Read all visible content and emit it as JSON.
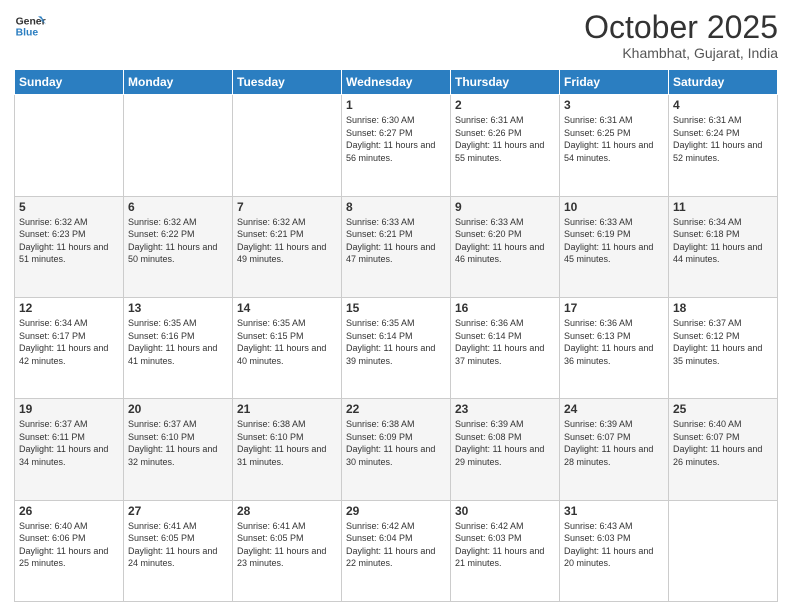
{
  "header": {
    "logo_line1": "General",
    "logo_line2": "Blue",
    "month": "October 2025",
    "location": "Khambhat, Gujarat, India"
  },
  "weekdays": [
    "Sunday",
    "Monday",
    "Tuesday",
    "Wednesday",
    "Thursday",
    "Friday",
    "Saturday"
  ],
  "weeks": [
    [
      {
        "day": "",
        "sunrise": "",
        "sunset": "",
        "daylight": ""
      },
      {
        "day": "",
        "sunrise": "",
        "sunset": "",
        "daylight": ""
      },
      {
        "day": "",
        "sunrise": "",
        "sunset": "",
        "daylight": ""
      },
      {
        "day": "1",
        "sunrise": "Sunrise: 6:30 AM",
        "sunset": "Sunset: 6:27 PM",
        "daylight": "Daylight: 11 hours and 56 minutes."
      },
      {
        "day": "2",
        "sunrise": "Sunrise: 6:31 AM",
        "sunset": "Sunset: 6:26 PM",
        "daylight": "Daylight: 11 hours and 55 minutes."
      },
      {
        "day": "3",
        "sunrise": "Sunrise: 6:31 AM",
        "sunset": "Sunset: 6:25 PM",
        "daylight": "Daylight: 11 hours and 54 minutes."
      },
      {
        "day": "4",
        "sunrise": "Sunrise: 6:31 AM",
        "sunset": "Sunset: 6:24 PM",
        "daylight": "Daylight: 11 hours and 52 minutes."
      }
    ],
    [
      {
        "day": "5",
        "sunrise": "Sunrise: 6:32 AM",
        "sunset": "Sunset: 6:23 PM",
        "daylight": "Daylight: 11 hours and 51 minutes."
      },
      {
        "day": "6",
        "sunrise": "Sunrise: 6:32 AM",
        "sunset": "Sunset: 6:22 PM",
        "daylight": "Daylight: 11 hours and 50 minutes."
      },
      {
        "day": "7",
        "sunrise": "Sunrise: 6:32 AM",
        "sunset": "Sunset: 6:21 PM",
        "daylight": "Daylight: 11 hours and 49 minutes."
      },
      {
        "day": "8",
        "sunrise": "Sunrise: 6:33 AM",
        "sunset": "Sunset: 6:21 PM",
        "daylight": "Daylight: 11 hours and 47 minutes."
      },
      {
        "day": "9",
        "sunrise": "Sunrise: 6:33 AM",
        "sunset": "Sunset: 6:20 PM",
        "daylight": "Daylight: 11 hours and 46 minutes."
      },
      {
        "day": "10",
        "sunrise": "Sunrise: 6:33 AM",
        "sunset": "Sunset: 6:19 PM",
        "daylight": "Daylight: 11 hours and 45 minutes."
      },
      {
        "day": "11",
        "sunrise": "Sunrise: 6:34 AM",
        "sunset": "Sunset: 6:18 PM",
        "daylight": "Daylight: 11 hours and 44 minutes."
      }
    ],
    [
      {
        "day": "12",
        "sunrise": "Sunrise: 6:34 AM",
        "sunset": "Sunset: 6:17 PM",
        "daylight": "Daylight: 11 hours and 42 minutes."
      },
      {
        "day": "13",
        "sunrise": "Sunrise: 6:35 AM",
        "sunset": "Sunset: 6:16 PM",
        "daylight": "Daylight: 11 hours and 41 minutes."
      },
      {
        "day": "14",
        "sunrise": "Sunrise: 6:35 AM",
        "sunset": "Sunset: 6:15 PM",
        "daylight": "Daylight: 11 hours and 40 minutes."
      },
      {
        "day": "15",
        "sunrise": "Sunrise: 6:35 AM",
        "sunset": "Sunset: 6:14 PM",
        "daylight": "Daylight: 11 hours and 39 minutes."
      },
      {
        "day": "16",
        "sunrise": "Sunrise: 6:36 AM",
        "sunset": "Sunset: 6:14 PM",
        "daylight": "Daylight: 11 hours and 37 minutes."
      },
      {
        "day": "17",
        "sunrise": "Sunrise: 6:36 AM",
        "sunset": "Sunset: 6:13 PM",
        "daylight": "Daylight: 11 hours and 36 minutes."
      },
      {
        "day": "18",
        "sunrise": "Sunrise: 6:37 AM",
        "sunset": "Sunset: 6:12 PM",
        "daylight": "Daylight: 11 hours and 35 minutes."
      }
    ],
    [
      {
        "day": "19",
        "sunrise": "Sunrise: 6:37 AM",
        "sunset": "Sunset: 6:11 PM",
        "daylight": "Daylight: 11 hours and 34 minutes."
      },
      {
        "day": "20",
        "sunrise": "Sunrise: 6:37 AM",
        "sunset": "Sunset: 6:10 PM",
        "daylight": "Daylight: 11 hours and 32 minutes."
      },
      {
        "day": "21",
        "sunrise": "Sunrise: 6:38 AM",
        "sunset": "Sunset: 6:10 PM",
        "daylight": "Daylight: 11 hours and 31 minutes."
      },
      {
        "day": "22",
        "sunrise": "Sunrise: 6:38 AM",
        "sunset": "Sunset: 6:09 PM",
        "daylight": "Daylight: 11 hours and 30 minutes."
      },
      {
        "day": "23",
        "sunrise": "Sunrise: 6:39 AM",
        "sunset": "Sunset: 6:08 PM",
        "daylight": "Daylight: 11 hours and 29 minutes."
      },
      {
        "day": "24",
        "sunrise": "Sunrise: 6:39 AM",
        "sunset": "Sunset: 6:07 PM",
        "daylight": "Daylight: 11 hours and 28 minutes."
      },
      {
        "day": "25",
        "sunrise": "Sunrise: 6:40 AM",
        "sunset": "Sunset: 6:07 PM",
        "daylight": "Daylight: 11 hours and 26 minutes."
      }
    ],
    [
      {
        "day": "26",
        "sunrise": "Sunrise: 6:40 AM",
        "sunset": "Sunset: 6:06 PM",
        "daylight": "Daylight: 11 hours and 25 minutes."
      },
      {
        "day": "27",
        "sunrise": "Sunrise: 6:41 AM",
        "sunset": "Sunset: 6:05 PM",
        "daylight": "Daylight: 11 hours and 24 minutes."
      },
      {
        "day": "28",
        "sunrise": "Sunrise: 6:41 AM",
        "sunset": "Sunset: 6:05 PM",
        "daylight": "Daylight: 11 hours and 23 minutes."
      },
      {
        "day": "29",
        "sunrise": "Sunrise: 6:42 AM",
        "sunset": "Sunset: 6:04 PM",
        "daylight": "Daylight: 11 hours and 22 minutes."
      },
      {
        "day": "30",
        "sunrise": "Sunrise: 6:42 AM",
        "sunset": "Sunset: 6:03 PM",
        "daylight": "Daylight: 11 hours and 21 minutes."
      },
      {
        "day": "31",
        "sunrise": "Sunrise: 6:43 AM",
        "sunset": "Sunset: 6:03 PM",
        "daylight": "Daylight: 11 hours and 20 minutes."
      },
      {
        "day": "",
        "sunrise": "",
        "sunset": "",
        "daylight": ""
      }
    ]
  ]
}
